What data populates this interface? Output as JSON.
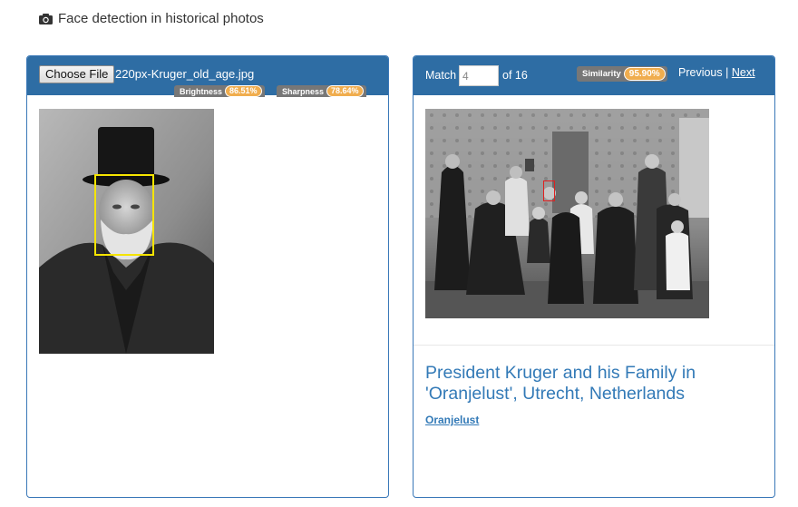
{
  "header": {
    "title": "Face detection in historical photos",
    "icon": "camera-icon"
  },
  "left_panel": {
    "choose_file_label": "Choose File",
    "file_name": "220px-Kruger_old_age.jpg",
    "brightness": {
      "label": "Brightness",
      "value": "86.51%"
    },
    "sharpness": {
      "label": "Sharpness",
      "value": "78.64%"
    }
  },
  "right_panel": {
    "match_label": "Match",
    "match_value": "4",
    "match_total": "of 16",
    "similarity": {
      "label": "Similarity",
      "value": "95.90%"
    },
    "previous_label": "Previous",
    "separator": " | ",
    "next_label": "Next",
    "photo_title": "President Kruger and his Family in 'Oranjelust', Utrecht, Netherlands",
    "photo_link": "Oranjelust"
  },
  "colors": {
    "panel_header": "#2e6da4",
    "panel_border": "#3a78b8",
    "badge_bg": "#777777",
    "badge_value": "#f0ad4e",
    "link": "#337ab7",
    "face_box": "#f5e400",
    "match_box": "#e02020"
  }
}
